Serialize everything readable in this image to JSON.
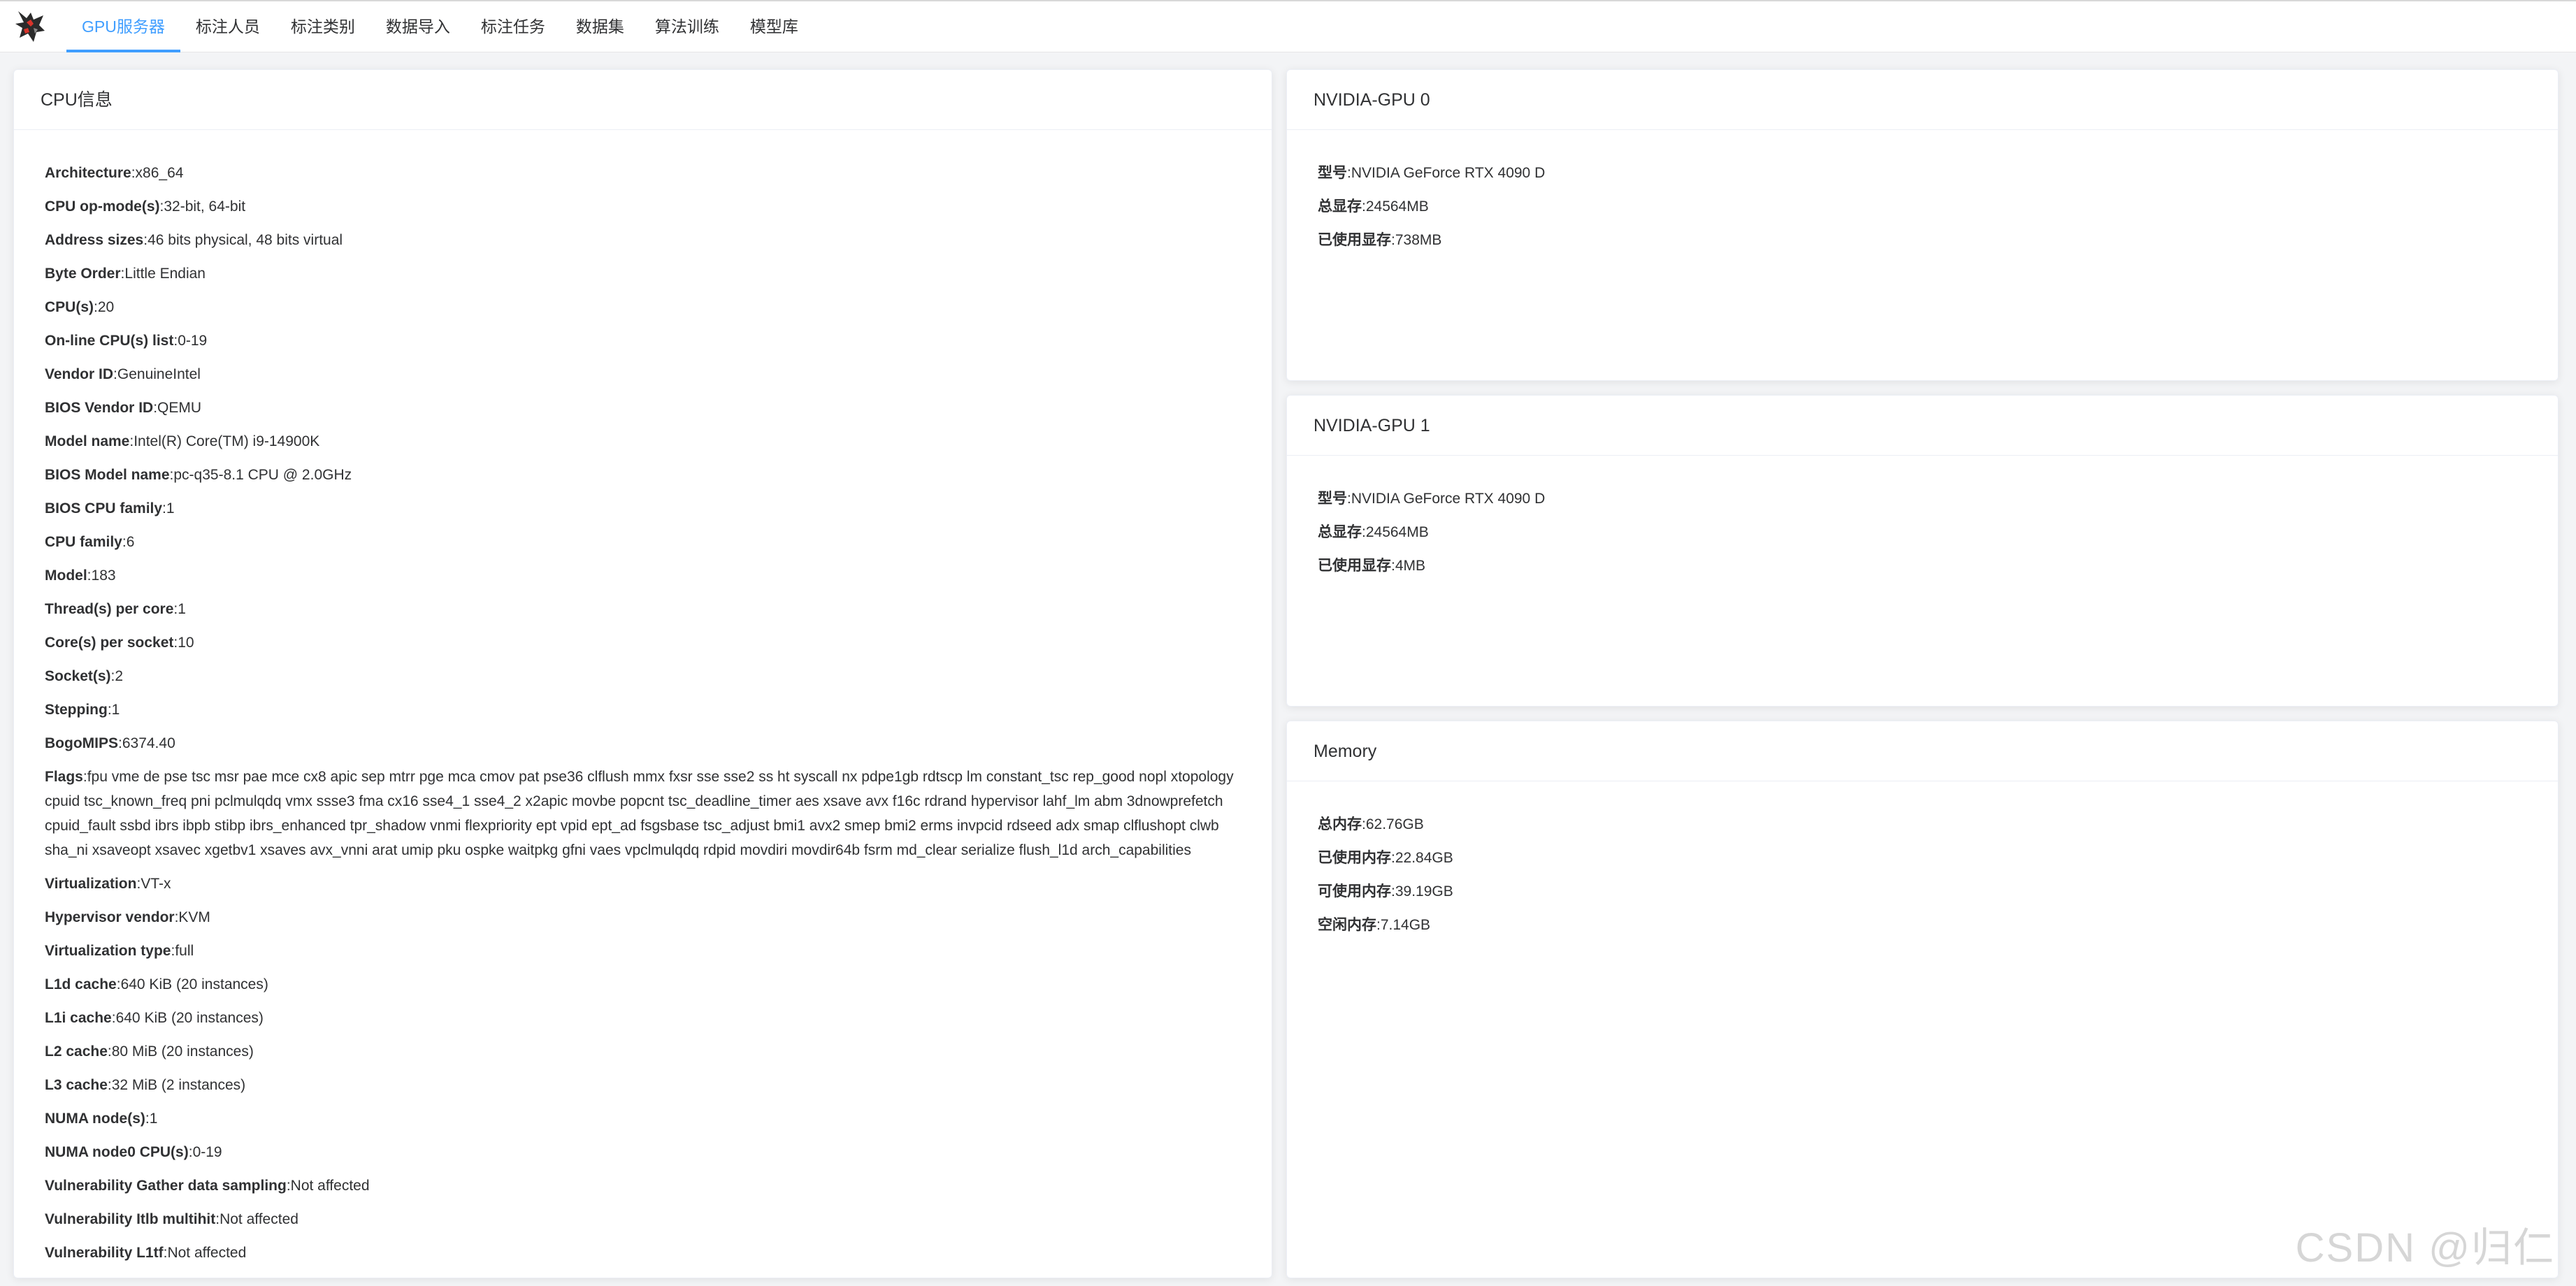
{
  "nav": {
    "items": [
      {
        "label": "GPU服务器",
        "active": true
      },
      {
        "label": "标注人员",
        "active": false
      },
      {
        "label": "标注类别",
        "active": false
      },
      {
        "label": "数据导入",
        "active": false
      },
      {
        "label": "标注任务",
        "active": false
      },
      {
        "label": "数据集",
        "active": false
      },
      {
        "label": "算法训练",
        "active": false
      },
      {
        "label": "模型库",
        "active": false
      }
    ]
  },
  "cpu": {
    "title": "CPU信息",
    "rows": [
      {
        "key": "Architecture",
        "value": "x86_64"
      },
      {
        "key": "CPU op-mode(s)",
        "value": "32-bit, 64-bit"
      },
      {
        "key": "Address sizes",
        "value": "46 bits physical, 48 bits virtual"
      },
      {
        "key": "Byte Order",
        "value": "Little Endian"
      },
      {
        "key": "CPU(s)",
        "value": "20"
      },
      {
        "key": "On-line CPU(s) list",
        "value": "0-19"
      },
      {
        "key": "Vendor ID",
        "value": "GenuineIntel"
      },
      {
        "key": "BIOS Vendor ID",
        "value": "QEMU"
      },
      {
        "key": "Model name",
        "value": "Intel(R) Core(TM) i9-14900K"
      },
      {
        "key": "BIOS Model name",
        "value": "pc-q35-8.1 CPU @ 2.0GHz"
      },
      {
        "key": "BIOS CPU family",
        "value": "1"
      },
      {
        "key": "CPU family",
        "value": "6"
      },
      {
        "key": "Model",
        "value": "183"
      },
      {
        "key": "Thread(s) per core",
        "value": "1"
      },
      {
        "key": "Core(s) per socket",
        "value": "10"
      },
      {
        "key": "Socket(s)",
        "value": "2"
      },
      {
        "key": "Stepping",
        "value": "1"
      },
      {
        "key": "BogoMIPS",
        "value": "6374.40"
      },
      {
        "key": "Flags",
        "value": "fpu vme de pse tsc msr pae mce cx8 apic sep mtrr pge mca cmov pat pse36 clflush mmx fxsr sse sse2 ss ht syscall nx pdpe1gb rdtscp lm constant_tsc rep_good nopl xtopology cpuid tsc_known_freq pni pclmulqdq vmx ssse3 fma cx16 sse4_1 sse4_2 x2apic movbe popcnt tsc_deadline_timer aes xsave avx f16c rdrand hypervisor lahf_lm abm 3dnowprefetch cpuid_fault ssbd ibrs ibpb stibp ibrs_enhanced tpr_shadow vnmi flexpriority ept vpid ept_ad fsgsbase tsc_adjust bmi1 avx2 smep bmi2 erms invpcid rdseed adx smap clflushopt clwb sha_ni xsaveopt xsavec xgetbv1 xsaves avx_vnni arat umip pku ospke waitpkg gfni vaes vpclmulqdq rdpid movdiri movdir64b fsrm md_clear serialize flush_l1d arch_capabilities"
      },
      {
        "key": "Virtualization",
        "value": "VT-x"
      },
      {
        "key": "Hypervisor vendor",
        "value": "KVM"
      },
      {
        "key": "Virtualization type",
        "value": "full"
      },
      {
        "key": "L1d cache",
        "value": "640 KiB (20 instances)"
      },
      {
        "key": "L1i cache",
        "value": "640 KiB (20 instances)"
      },
      {
        "key": "L2 cache",
        "value": "80 MiB (20 instances)"
      },
      {
        "key": "L3 cache",
        "value": "32 MiB (2 instances)"
      },
      {
        "key": "NUMA node(s)",
        "value": "1"
      },
      {
        "key": "NUMA node0 CPU(s)",
        "value": "0-19"
      },
      {
        "key": "Vulnerability Gather data sampling",
        "value": "Not affected"
      },
      {
        "key": "Vulnerability Itlb multihit",
        "value": "Not affected"
      },
      {
        "key": "Vulnerability L1tf",
        "value": "Not affected"
      }
    ]
  },
  "gpu0": {
    "title": "NVIDIA-GPU 0",
    "rows": [
      {
        "key": "型号",
        "value": "NVIDIA GeForce RTX 4090 D"
      },
      {
        "key": "总显存",
        "value": "24564MB"
      },
      {
        "key": "已使用显存",
        "value": "738MB"
      }
    ]
  },
  "gpu1": {
    "title": "NVIDIA-GPU 1",
    "rows": [
      {
        "key": "型号",
        "value": "NVIDIA GeForce RTX 4090 D"
      },
      {
        "key": "总显存",
        "value": "24564MB"
      },
      {
        "key": "已使用显存",
        "value": "4MB"
      }
    ]
  },
  "memory": {
    "title": "Memory",
    "rows": [
      {
        "key": "总内存",
        "value": "62.76GB"
      },
      {
        "key": "已使用内存",
        "value": "22.84GB"
      },
      {
        "key": "可使用内存",
        "value": "39.19GB"
      },
      {
        "key": "空闲内存",
        "value": "7.14GB"
      }
    ]
  },
  "watermark": "CSDN @归仁",
  "colors": {
    "accent": "#409eff",
    "background": "#f3f4f6",
    "text": "#303133"
  },
  "icons": {
    "logo": "wolf-logo-icon"
  }
}
